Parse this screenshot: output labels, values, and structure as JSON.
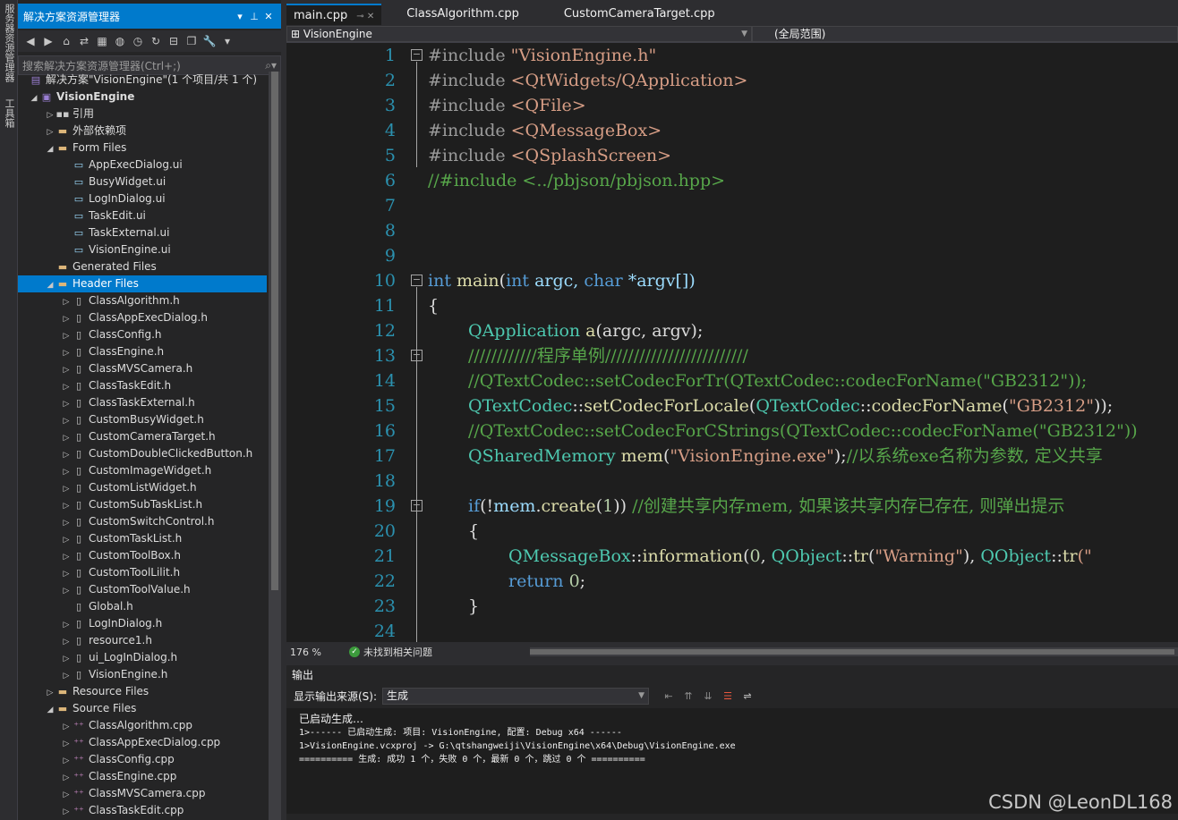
{
  "left_strip": {
    "tab1": "服务器资源管理器",
    "tab2": "工具箱"
  },
  "solution_explorer": {
    "title": "解决方案资源管理器",
    "search_placeholder": "搜索解决方案资源管理器(Ctrl+;)",
    "tree": [
      {
        "label": "解决方案\"VisionEngine\"(1 个项目/共 1 个)",
        "level": 0,
        "arrow": "",
        "icon": "solution"
      },
      {
        "label": "VisionEngine",
        "level": 0,
        "arrow": "open",
        "icon": "project"
      },
      {
        "label": "引用",
        "level": 1,
        "arrow": "closed",
        "icon": "ref"
      },
      {
        "label": "外部依赖项",
        "level": 1,
        "arrow": "closed",
        "icon": "ext"
      },
      {
        "label": "Form Files",
        "level": 1,
        "arrow": "open",
        "icon": "folder"
      },
      {
        "label": "AppExecDialog.ui",
        "level": 2,
        "arrow": "",
        "icon": "ui"
      },
      {
        "label": "BusyWidget.ui",
        "level": 2,
        "arrow": "",
        "icon": "ui"
      },
      {
        "label": "LogInDialog.ui",
        "level": 2,
        "arrow": "",
        "icon": "ui"
      },
      {
        "label": "TaskEdit.ui",
        "level": 2,
        "arrow": "",
        "icon": "ui"
      },
      {
        "label": "TaskExternal.ui",
        "level": 2,
        "arrow": "",
        "icon": "ui"
      },
      {
        "label": "VisionEngine.ui",
        "level": 2,
        "arrow": "",
        "icon": "ui"
      },
      {
        "label": "Generated Files",
        "level": 1,
        "arrow": "",
        "icon": "folder"
      },
      {
        "label": "Header Files",
        "level": 1,
        "arrow": "open",
        "icon": "folder",
        "selected": true
      },
      {
        "label": "ClassAlgorithm.h",
        "level": 2,
        "arrow": "closed",
        "icon": "h"
      },
      {
        "label": "ClassAppExecDialog.h",
        "level": 2,
        "arrow": "closed",
        "icon": "h"
      },
      {
        "label": "ClassConfig.h",
        "level": 2,
        "arrow": "closed",
        "icon": "h"
      },
      {
        "label": "ClassEngine.h",
        "level": 2,
        "arrow": "closed",
        "icon": "h"
      },
      {
        "label": "ClassMVSCamera.h",
        "level": 2,
        "arrow": "closed",
        "icon": "h"
      },
      {
        "label": "ClassTaskEdit.h",
        "level": 2,
        "arrow": "closed",
        "icon": "h"
      },
      {
        "label": "ClassTaskExternal.h",
        "level": 2,
        "arrow": "closed",
        "icon": "h"
      },
      {
        "label": "CustomBusyWidget.h",
        "level": 2,
        "arrow": "closed",
        "icon": "h"
      },
      {
        "label": "CustomCameraTarget.h",
        "level": 2,
        "arrow": "closed",
        "icon": "h"
      },
      {
        "label": "CustomDoubleClickedButton.h",
        "level": 2,
        "arrow": "closed",
        "icon": "h"
      },
      {
        "label": "CustomImageWidget.h",
        "level": 2,
        "arrow": "closed",
        "icon": "h"
      },
      {
        "label": "CustomListWidget.h",
        "level": 2,
        "arrow": "closed",
        "icon": "h"
      },
      {
        "label": "CustomSubTaskList.h",
        "level": 2,
        "arrow": "closed",
        "icon": "h"
      },
      {
        "label": "CustomSwitchControl.h",
        "level": 2,
        "arrow": "closed",
        "icon": "h"
      },
      {
        "label": "CustomTaskList.h",
        "level": 2,
        "arrow": "closed",
        "icon": "h"
      },
      {
        "label": "CustomToolBox.h",
        "level": 2,
        "arrow": "closed",
        "icon": "h"
      },
      {
        "label": "CustomToolLilit.h",
        "level": 2,
        "arrow": "closed",
        "icon": "h"
      },
      {
        "label": "CustomToolValue.h",
        "level": 2,
        "arrow": "closed",
        "icon": "h"
      },
      {
        "label": "Global.h",
        "level": 2,
        "arrow": "",
        "icon": "h"
      },
      {
        "label": "LogInDialog.h",
        "level": 2,
        "arrow": "closed",
        "icon": "h"
      },
      {
        "label": "resource1.h",
        "level": 2,
        "arrow": "closed",
        "icon": "h"
      },
      {
        "label": "ui_LogInDialog.h",
        "level": 2,
        "arrow": "closed",
        "icon": "h"
      },
      {
        "label": "VisionEngine.h",
        "level": 2,
        "arrow": "closed",
        "icon": "h"
      },
      {
        "label": "Resource Files",
        "level": 1,
        "arrow": "closed",
        "icon": "folder"
      },
      {
        "label": "Source Files",
        "level": 1,
        "arrow": "open",
        "icon": "folder"
      },
      {
        "label": "ClassAlgorithm.cpp",
        "level": 2,
        "arrow": "closed",
        "icon": "cpp"
      },
      {
        "label": "ClassAppExecDialog.cpp",
        "level": 2,
        "arrow": "closed",
        "icon": "cpp"
      },
      {
        "label": "ClassConfig.cpp",
        "level": 2,
        "arrow": "closed",
        "icon": "cpp"
      },
      {
        "label": "ClassEngine.cpp",
        "level": 2,
        "arrow": "closed",
        "icon": "cpp"
      },
      {
        "label": "ClassMVSCamera.cpp",
        "level": 2,
        "arrow": "closed",
        "icon": "cpp"
      },
      {
        "label": "ClassTaskEdit.cpp",
        "level": 2,
        "arrow": "closed",
        "icon": "cpp"
      }
    ]
  },
  "editor": {
    "tabs": [
      {
        "label": "main.cpp",
        "active": true
      },
      {
        "label": "ClassAlgorithm.cpp",
        "active": false
      },
      {
        "label": "CustomCameraTarget.cpp",
        "active": false
      }
    ],
    "nav_project": "VisionEngine",
    "nav_scope": "(全局范围)",
    "zoom": "176 %",
    "issues": "未找到相关问题",
    "line_numbers": [
      "1",
      "2",
      "3",
      "4",
      "5",
      "6",
      "7",
      "8",
      "9",
      "10",
      "11",
      "12",
      "13",
      "14",
      "15",
      "16",
      "17",
      "18",
      "19",
      "20",
      "21",
      "22",
      "23",
      "24"
    ],
    "code": {
      "l1a": "#include ",
      "l1b": "\"VisionEngine.h\"",
      "l2a": "#include ",
      "l2b": "<QtWidgets/QApplication>",
      "l3a": "#include ",
      "l3b": "<QFile>",
      "l4a": "#include ",
      "l4b": "<QMessageBox>",
      "l5a": "#include ",
      "l5b": "<QSplashScreen>",
      "l6": "//#include <../pbjson/pbjson.hpp>",
      "l10a": "int",
      "l10b": " main",
      "l10c": "(",
      "l10d": "int",
      "l10e": " argc, ",
      "l10f": "char",
      "l10g": " *argv[])",
      "l11": "{",
      "l12a": "QApplication",
      "l12b": " a",
      "l12c": "(argc, argv);",
      "l13": "////////////程序单例/////////////////////////",
      "l14": "//QTextCodec::setCodecForTr(QTextCodec::codecForName(\"GB2312\"));",
      "l15a": "QTextCodec",
      "l15b": "::",
      "l15c": "setCodecForLocale",
      "l15d": "(",
      "l15e": "QTextCodec",
      "l15f": "::",
      "l15g": "codecForName",
      "l15h": "(",
      "l15i": "\"GB2312\"",
      "l15j": "));",
      "l16": "//QTextCodec::setCodecForCStrings(QTextCodec::codecForName(\"GB2312\"))",
      "l17a": "QSharedMemory",
      "l17b": " mem",
      "l17c": "(",
      "l17d": "\"VisionEngine.exe\"",
      "l17e": ");",
      "l17f": "//以系统exe名称为参数, 定义共享",
      "l19a": "if",
      "l19b": "(!",
      "l19c": "mem",
      "l19d": ".",
      "l19e": "create",
      "l19f": "(",
      "l19g": "1",
      "l19h": ")) ",
      "l19i": "//创建共享内存mem, 如果该共享内存已存在, 则弹出提示",
      "l20": "{",
      "l21a": "QMessageBox",
      "l21b": "::",
      "l21c": "information",
      "l21d": "(",
      "l21e": "0",
      "l21f": ", ",
      "l21g": "QObject",
      "l21h": "::",
      "l21i": "tr",
      "l21j": "(",
      "l21k": "\"Warning\"",
      "l21l": "), ",
      "l21m": "QObject",
      "l21n": "::",
      "l21o": "tr",
      "l21p": "(\"",
      "l22a": "return",
      "l22b": " ",
      "l22c": "0",
      "l22d": ";",
      "l23": "}"
    }
  },
  "output": {
    "title": "输出",
    "source_label": "显示输出来源(S):",
    "source_value": "生成",
    "lines": [
      "已启动生成…",
      "1>------ 已启动生成: 项目: VisionEngine, 配置: Debug x64 ------",
      "1>VisionEngine.vcxproj -> G:\\qtshangweiji\\VisionEngine\\x64\\Debug\\VisionEngine.exe",
      "========== 生成: 成功 1 个，失败 0 个，最新 0 个，跳过 0 个 =========="
    ]
  },
  "watermark": "CSDN @LeonDL168"
}
